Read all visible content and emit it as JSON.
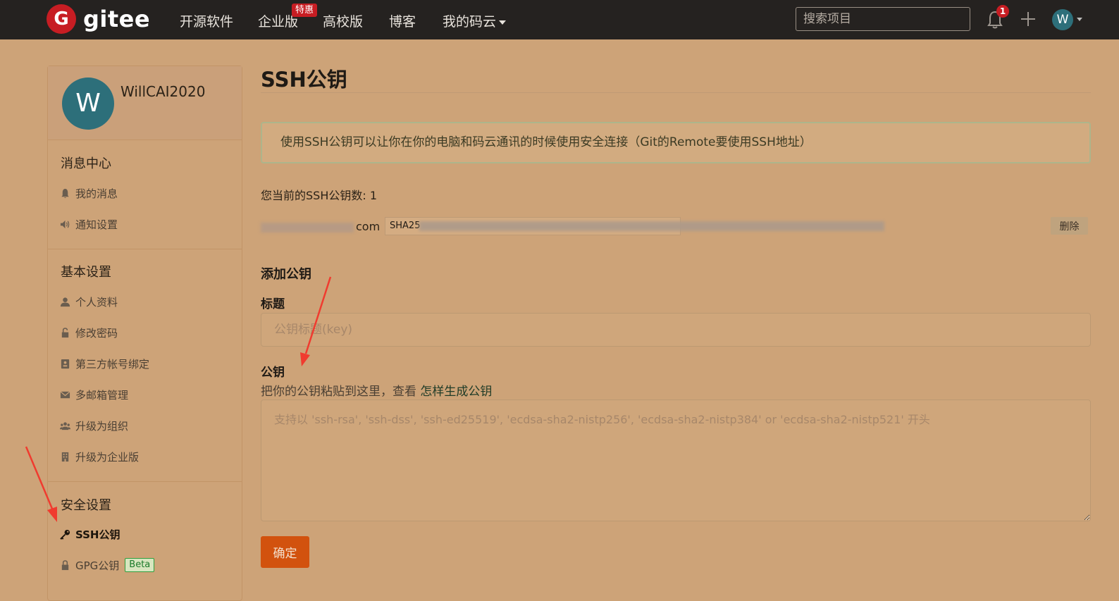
{
  "topnav": {
    "logo_glyph": "G",
    "logo_text": "gitee",
    "items": [
      "开源软件",
      "企业版",
      "高校版",
      "博客",
      "我的码云"
    ],
    "hot_badge": "特惠",
    "search_placeholder": "搜索项目",
    "notification_count": "1",
    "avatar_letter": "W"
  },
  "sidebar": {
    "avatar_letter": "W",
    "username": "WillCAI2020",
    "sections": [
      {
        "title": "消息中心",
        "items": [
          {
            "label": "我的消息",
            "icon": "bell-icon"
          },
          {
            "label": "通知设置",
            "icon": "volume-icon"
          }
        ]
      },
      {
        "title": "基本设置",
        "items": [
          {
            "label": "个人资料",
            "icon": "user-icon"
          },
          {
            "label": "修改密码",
            "icon": "unlock-icon"
          },
          {
            "label": "第三方帐号绑定",
            "icon": "id-card-icon"
          },
          {
            "label": "多邮箱管理",
            "icon": "envelope-icon"
          },
          {
            "label": "升级为组织",
            "icon": "group-icon"
          },
          {
            "label": "升级为企业版",
            "icon": "building-icon"
          }
        ]
      },
      {
        "title": "安全设置",
        "items": [
          {
            "label": "SSH公钥",
            "icon": "key-icon",
            "active": true
          },
          {
            "label": "GPG公钥",
            "icon": "lock-icon",
            "badge": "Beta"
          }
        ]
      }
    ]
  },
  "main": {
    "title": "SSH公钥",
    "info": "使用SSH公钥可以让你在你的电脑和码云通讯的时候使用安全连接（Git的Remote要使用SSH地址）",
    "key_count_label": "您当前的SSH公钥数: 1",
    "existing_key": {
      "email_suffix": "com",
      "fingerprint_prefix": "SHA25",
      "delete_label": "删除"
    },
    "add_heading": "添加公钥",
    "title_label": "标题",
    "title_placeholder": "公钥标题(key)",
    "key_label": "公钥",
    "key_help": "把你的公钥粘贴到这里，查看",
    "key_help_link": "怎样生成公钥",
    "key_placeholder": "支持以 'ssh-rsa', 'ssh-dss', 'ssh-ed25519', 'ecdsa-sha2-nistp256', 'ecdsa-sha2-nistp384' or 'ecdsa-sha2-nistp521' 开头",
    "submit_label": "确定"
  },
  "colors": {
    "topbar": "#252220",
    "page_bg": "#cda378",
    "brand_red": "#c71d23",
    "submit": "#d2520e",
    "annotation_arrow": "#f03b2f"
  }
}
